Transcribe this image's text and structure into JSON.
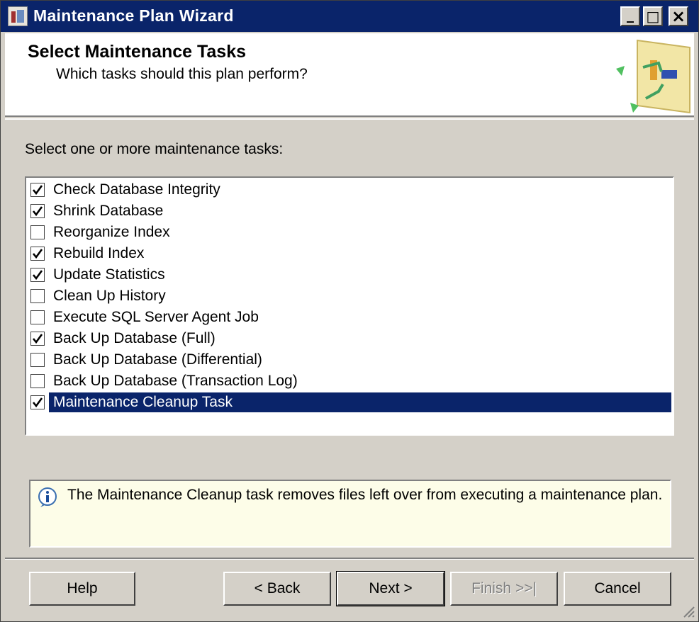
{
  "window": {
    "title": "Maintenance Plan Wizard",
    "controls": {
      "minimize": "_",
      "maximize": "□",
      "close": "×"
    }
  },
  "header": {
    "title": "Select Maintenance Tasks",
    "subtitle": "Which tasks should this plan perform?"
  },
  "task_section": {
    "label": "Select one or more maintenance tasks:",
    "tasks": [
      {
        "label": "Check Database Integrity",
        "checked": true
      },
      {
        "label": "Shrink Database",
        "checked": true
      },
      {
        "label": "Reorganize Index",
        "checked": false
      },
      {
        "label": "Rebuild Index",
        "checked": true
      },
      {
        "label": "Update Statistics",
        "checked": true
      },
      {
        "label": "Clean Up History",
        "checked": false
      },
      {
        "label": "Execute SQL Server Agent Job",
        "checked": false
      },
      {
        "label": "Back Up Database (Full)",
        "checked": true
      },
      {
        "label": "Back Up Database (Differential)",
        "checked": false
      },
      {
        "label": "Back Up Database (Transaction Log)",
        "checked": false
      },
      {
        "label": "Maintenance Cleanup Task",
        "checked": true,
        "selected": true
      }
    ]
  },
  "info": {
    "icon": "info-icon",
    "text": "The Maintenance Cleanup task removes files left over from executing a maintenance plan."
  },
  "buttons": {
    "help": "Help",
    "back": "< Back",
    "next": "Next >",
    "finish": ">>|",
    "finish_prefix": "Finish ",
    "cancel": "Cancel"
  },
  "colors": {
    "titlebar": "#0a246a",
    "selection": "#0a246a",
    "face": "#d4d0c8",
    "info_bg": "#fdfde8"
  }
}
